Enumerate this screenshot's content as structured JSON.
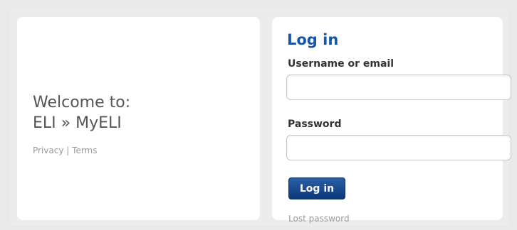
{
  "welcome": {
    "line1": "Welcome to:",
    "line2": "ELI » MyELI",
    "privacy_link": "Privacy",
    "separator": "|",
    "terms_link": "Terms"
  },
  "login": {
    "title": "Log in",
    "username_label": "Username or email",
    "username_value": "",
    "password_label": "Password",
    "password_value": "",
    "submit_label": "Log in",
    "lost_password_link": "Lost password"
  },
  "colors": {
    "accent": "#1a56a6",
    "button_bg": "#0d3878",
    "background": "#e9e9e9",
    "panel": "#ffffff"
  }
}
